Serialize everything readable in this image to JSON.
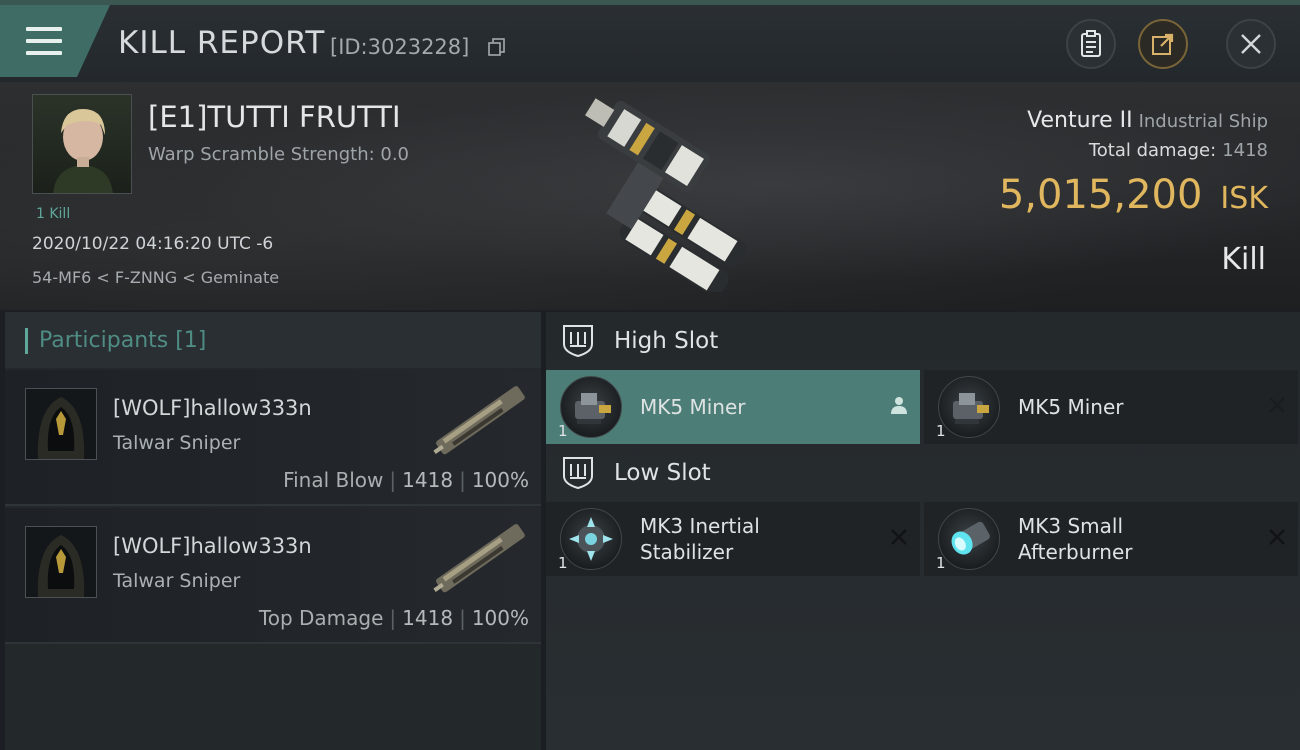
{
  "header": {
    "title": "KILL REPORT",
    "report_id": "[ID:3023228]",
    "buttons": [
      "clipboard-icon",
      "share-icon",
      "close-icon"
    ]
  },
  "victim": {
    "name": "[E1]TUTTI FRUTTI",
    "warp_scramble": "Warp Scramble Strength: 0.0",
    "kills": "1 Kill",
    "datetime": "2020/10/22 04:16:20 UTC -6",
    "location": "54-MF6 < F-ZNNG < Geminate",
    "ship_name": "Venture II",
    "ship_class": "Industrial Ship",
    "total_damage_label": "Total damage:",
    "total_damage": "1418",
    "isk_value": "5,015,200",
    "isk_unit": "ISK",
    "result": "Kill"
  },
  "participants": {
    "header": "Participants [1]",
    "items": [
      {
        "name": "[WOLF]hallow333n",
        "ship": "Talwar Sniper",
        "label": "Final Blow",
        "damage": "1418",
        "percent": "100%"
      },
      {
        "name": "[WOLF]hallow333n",
        "ship": "Talwar Sniper",
        "label": "Top Damage",
        "damage": "1418",
        "percent": "100%"
      }
    ]
  },
  "slots": {
    "high": {
      "label": "High Slot",
      "modules": [
        {
          "qty": "1",
          "name": "MK5 Miner",
          "status": "person-icon"
        },
        {
          "qty": "1",
          "name": "MK5 Miner",
          "status": "x-icon"
        }
      ]
    },
    "low": {
      "label": "Low Slot",
      "modules": [
        {
          "qty": "1",
          "name_line1": "MK3 Inertial",
          "name_line2": "Stabilizer",
          "status": "x-icon"
        },
        {
          "qty": "1",
          "name_line1": "MK3 Small",
          "name_line2": "Afterburner",
          "status": "x-icon"
        }
      ]
    }
  },
  "colors": {
    "accent": "#4c7e77",
    "isk": "#e0b65e",
    "teal_text": "#5fa79b"
  }
}
